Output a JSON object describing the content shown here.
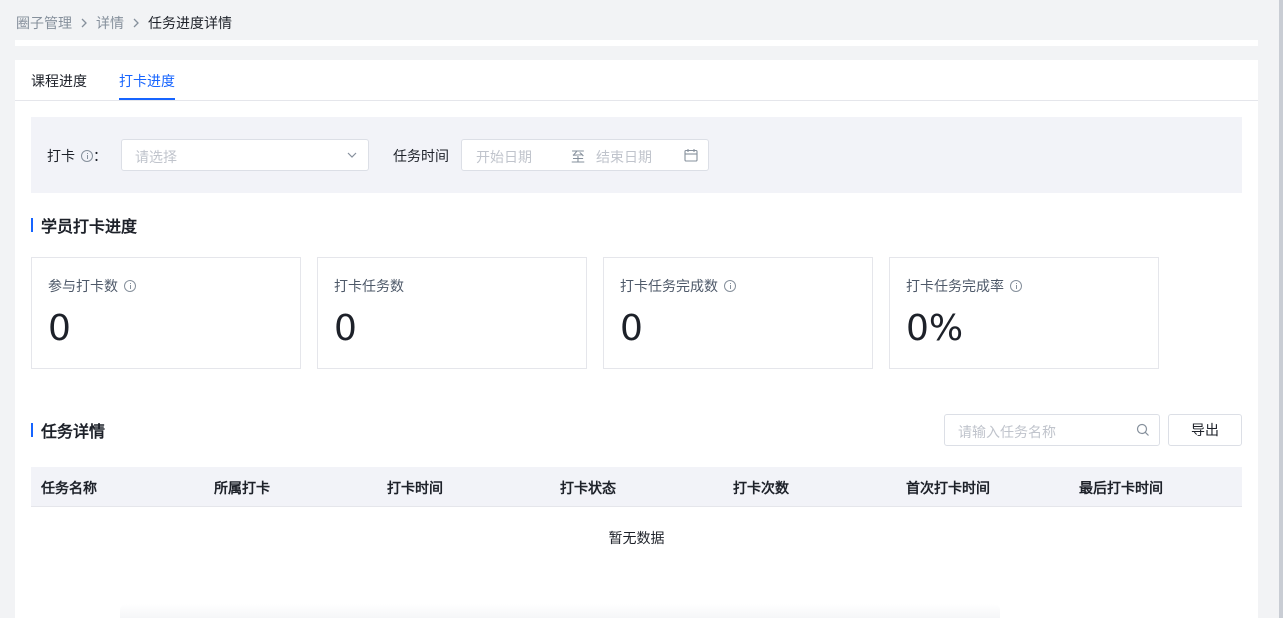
{
  "breadcrumb": {
    "items": [
      "圈子管理",
      "详情",
      "任务进度详情"
    ]
  },
  "tabs": [
    {
      "label": "课程进度",
      "active": false
    },
    {
      "label": "打卡进度",
      "active": true
    }
  ],
  "filters": {
    "checkin_label": "打卡",
    "checkin_colon": "：",
    "checkin_placeholder": "请选择",
    "time_label": "任务时间",
    "start_placeholder": "开始日期",
    "separator": "至",
    "end_placeholder": "结束日期"
  },
  "progress_section": {
    "title": "学员打卡进度",
    "stats": [
      {
        "label": "参与打卡数",
        "value": "0",
        "info": true
      },
      {
        "label": "打卡任务数",
        "value": "0",
        "info": false
      },
      {
        "label": "打卡任务完成数",
        "value": "0",
        "info": true
      },
      {
        "label": "打卡任务完成率",
        "value": "0%",
        "info": true
      }
    ]
  },
  "detail_section": {
    "title": "任务详情",
    "search_placeholder": "请输入任务名称",
    "export_label": "导出",
    "columns": [
      "任务名称",
      "所属打卡",
      "打卡时间",
      "打卡状态",
      "打卡次数",
      "首次打卡时间",
      "最后打卡时间"
    ],
    "empty_text": "暂无数据"
  },
  "colors": {
    "primary": "#1664ff",
    "text": "#1d2129",
    "muted": "#86909c",
    "panel": "#f2f3f8"
  },
  "icons": [
    "chevron-right-icon",
    "info-icon",
    "chevron-down-icon",
    "calendar-icon",
    "search-icon"
  ]
}
